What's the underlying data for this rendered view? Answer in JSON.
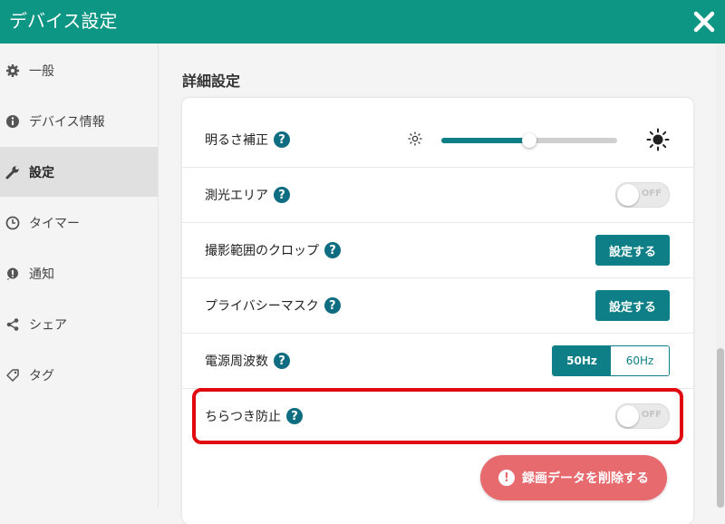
{
  "header": {
    "title": "デバイス設定"
  },
  "sidebar": {
    "items": [
      {
        "label": "一般",
        "icon": "gear-icon"
      },
      {
        "label": "デバイス情報",
        "icon": "info-icon"
      },
      {
        "label": "設定",
        "icon": "wrench-icon",
        "active": true
      },
      {
        "label": "タイマー",
        "icon": "clock-icon"
      },
      {
        "label": "通知",
        "icon": "notification-icon"
      },
      {
        "label": "シェア",
        "icon": "share-icon"
      },
      {
        "label": "タグ",
        "icon": "tag-icon"
      }
    ]
  },
  "main": {
    "section_title": "詳細設定",
    "rows": {
      "brightness": {
        "label": "明るさ補正",
        "value_fraction": 0.5
      },
      "metering": {
        "label": "測光エリア",
        "toggle": "OFF"
      },
      "crop": {
        "label": "撮影範囲のクロップ",
        "button": "設定する"
      },
      "privacy": {
        "label": "プライバシーマスク",
        "button": "設定する"
      },
      "frequency": {
        "label": "電源周波数",
        "options": [
          "50Hz",
          "60Hz"
        ],
        "selected": "50Hz"
      },
      "flicker": {
        "label": "ちらつき防止",
        "toggle": "OFF"
      }
    },
    "delete_button": "録画データを削除する"
  },
  "colors": {
    "header": "#0c9683",
    "accent": "#0e7f86",
    "danger": "#e76a6f",
    "highlight": "#e0070f"
  }
}
